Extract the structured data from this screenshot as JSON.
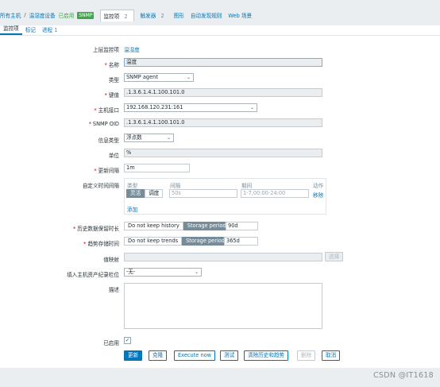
{
  "breadcrumb": {
    "all_hosts": "所有主机",
    "sep": "/",
    "host": "温湿度设备",
    "status": "已启用",
    "snmp": "SNMP"
  },
  "nav": {
    "items_label": "监控项",
    "items_count": "2",
    "triggers_label": "触发器",
    "triggers_count": "2",
    "graphs": "图形",
    "discovery": "自动发现规则",
    "web": "Web 场景"
  },
  "subtabs": {
    "item": "监控项",
    "tags": "标记",
    "preprocessing": "进程",
    "preprocessing_count": "1"
  },
  "form": {
    "parent_label": "上层监控项",
    "parent_value": "温湿度",
    "name_label": "名称",
    "name_value": "温度",
    "type_label": "类型",
    "type_value": "SNMP agent",
    "key_label": "键值",
    "key_value": ".1.3.6.1.4.1.100.101.0",
    "interface_label": "主机接口",
    "interface_value": "192.168.120.231:161",
    "oid_label": "SNMP OID",
    "oid_value": ".1.3.6.1.4.1.100.101.0",
    "info_type_label": "信息类型",
    "info_type_value": "浮点数",
    "units_label": "单位",
    "units_value": "%",
    "interval_label": "更新间隔",
    "interval_value": "1m",
    "custom_label": "自定义时间间隔",
    "custom": {
      "col_type": "类型",
      "col_interval": "间隔",
      "col_period": "期间",
      "col_action": "动作",
      "flexible": "灵活",
      "scheduling": "调度",
      "interval_placeholder": "50s",
      "period_placeholder": "1-7,00:00-24:00",
      "remove": "移除",
      "add": "添加"
    },
    "history_label": "历史数据保留时长",
    "history_opt1": "Do not keep history",
    "history_opt2": "Storage period",
    "history_value": "90d",
    "trends_label": "趋势存储时间",
    "trends_opt1": "Do not keep trends",
    "trends_opt2": "Storage period",
    "trends_value": "365d",
    "valuemap_label": "值映射",
    "valuemap_select": "选择",
    "inventory_label": "填入主机资产纪录栏位",
    "inventory_value": "-无-",
    "description_label": "描述",
    "enabled_label": "已启用",
    "enabled_mark": "✓"
  },
  "buttons": {
    "update": "更新",
    "clone": "克隆",
    "execute": "Execute now",
    "test": "测试",
    "clear": "清除历史和趋势",
    "delete": "删除",
    "cancel": "取消"
  },
  "watermark": "CSDN @IT1618",
  "icons": {
    "dropdown": "chevron-down-icon",
    "check": "check-icon"
  }
}
